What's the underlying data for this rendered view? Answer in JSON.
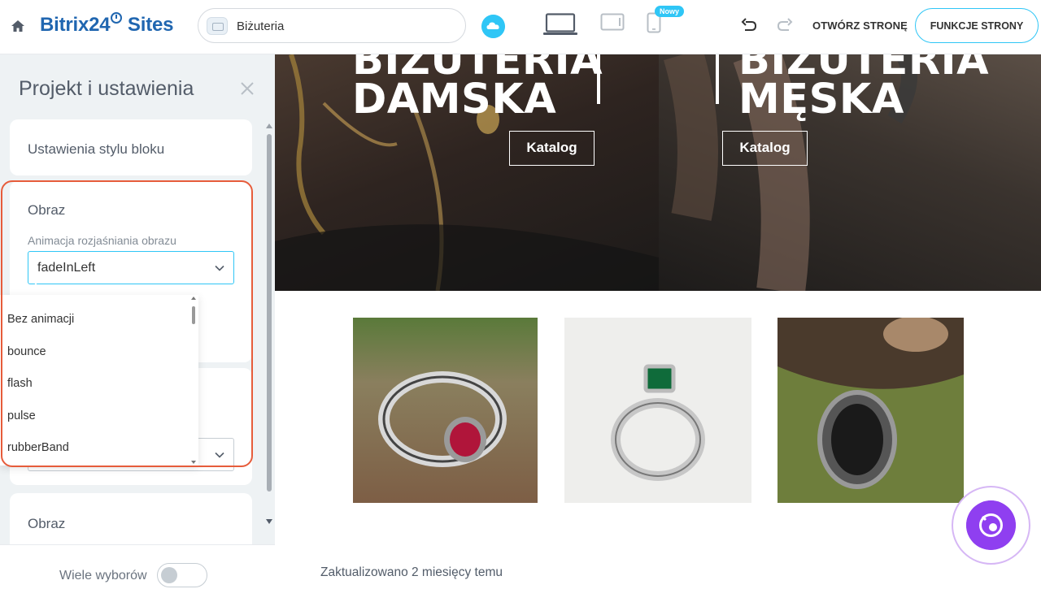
{
  "header": {
    "brand_text": "Bitrix24",
    "brand_suffix": "Sites",
    "site_name": "Biżuteria",
    "new_badge": "Nowy",
    "open_page_label": "OTWÓRZ STRONĘ",
    "features_label": "FUNKCJE STRONY"
  },
  "panel": {
    "title": "Projekt i ustawienia",
    "block_style_label": "Ustawienia stylu bloku",
    "image_label": "Obraz",
    "animation_label": "Animacja rozjaśniania obrazu",
    "animation_value": "fadeInLeft",
    "dropdown_options": [
      "Bez animacji",
      "bounce",
      "flash",
      "pulse",
      "rubberBand"
    ],
    "image2_label": "Obraz",
    "multi_select_label": "Wiele wyborów"
  },
  "main": {
    "hero_left": {
      "title_line1": "BIŻUTERIA",
      "title_line2": "DAMSKA",
      "button": "Katalog"
    },
    "hero_right": {
      "title_line1": "BIŻUTERIA",
      "title_line2": "MĘSKA",
      "button": "Katalog"
    },
    "updated_text": "Zaktualizowano 2 miesięcy temu"
  },
  "colors": {
    "accent": "#2fc6f6",
    "brand_dark": "#2066b0",
    "highlight": "#e65c3b",
    "fab": "#8f3ff0"
  },
  "icons": [
    "home-icon",
    "cloud-icon",
    "desktop-icon",
    "tablet-icon",
    "phone-icon",
    "undo-icon",
    "redo-icon",
    "close-icon",
    "chevron-down-icon",
    "copilot-icon"
  ]
}
